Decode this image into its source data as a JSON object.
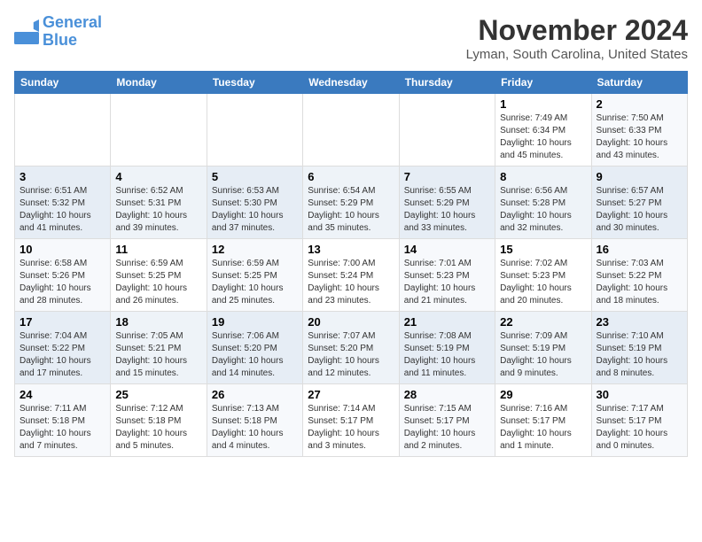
{
  "header": {
    "logo_line1": "General",
    "logo_line2": "Blue",
    "month": "November 2024",
    "location": "Lyman, South Carolina, United States"
  },
  "weekdays": [
    "Sunday",
    "Monday",
    "Tuesday",
    "Wednesday",
    "Thursday",
    "Friday",
    "Saturday"
  ],
  "weeks": [
    [
      {
        "day": "",
        "info": ""
      },
      {
        "day": "",
        "info": ""
      },
      {
        "day": "",
        "info": ""
      },
      {
        "day": "",
        "info": ""
      },
      {
        "day": "",
        "info": ""
      },
      {
        "day": "1",
        "info": "Sunrise: 7:49 AM\nSunset: 6:34 PM\nDaylight: 10 hours\nand 45 minutes."
      },
      {
        "day": "2",
        "info": "Sunrise: 7:50 AM\nSunset: 6:33 PM\nDaylight: 10 hours\nand 43 minutes."
      }
    ],
    [
      {
        "day": "3",
        "info": "Sunrise: 6:51 AM\nSunset: 5:32 PM\nDaylight: 10 hours\nand 41 minutes."
      },
      {
        "day": "4",
        "info": "Sunrise: 6:52 AM\nSunset: 5:31 PM\nDaylight: 10 hours\nand 39 minutes."
      },
      {
        "day": "5",
        "info": "Sunrise: 6:53 AM\nSunset: 5:30 PM\nDaylight: 10 hours\nand 37 minutes."
      },
      {
        "day": "6",
        "info": "Sunrise: 6:54 AM\nSunset: 5:29 PM\nDaylight: 10 hours\nand 35 minutes."
      },
      {
        "day": "7",
        "info": "Sunrise: 6:55 AM\nSunset: 5:29 PM\nDaylight: 10 hours\nand 33 minutes."
      },
      {
        "day": "8",
        "info": "Sunrise: 6:56 AM\nSunset: 5:28 PM\nDaylight: 10 hours\nand 32 minutes."
      },
      {
        "day": "9",
        "info": "Sunrise: 6:57 AM\nSunset: 5:27 PM\nDaylight: 10 hours\nand 30 minutes."
      }
    ],
    [
      {
        "day": "10",
        "info": "Sunrise: 6:58 AM\nSunset: 5:26 PM\nDaylight: 10 hours\nand 28 minutes."
      },
      {
        "day": "11",
        "info": "Sunrise: 6:59 AM\nSunset: 5:25 PM\nDaylight: 10 hours\nand 26 minutes."
      },
      {
        "day": "12",
        "info": "Sunrise: 6:59 AM\nSunset: 5:25 PM\nDaylight: 10 hours\nand 25 minutes."
      },
      {
        "day": "13",
        "info": "Sunrise: 7:00 AM\nSunset: 5:24 PM\nDaylight: 10 hours\nand 23 minutes."
      },
      {
        "day": "14",
        "info": "Sunrise: 7:01 AM\nSunset: 5:23 PM\nDaylight: 10 hours\nand 21 minutes."
      },
      {
        "day": "15",
        "info": "Sunrise: 7:02 AM\nSunset: 5:23 PM\nDaylight: 10 hours\nand 20 minutes."
      },
      {
        "day": "16",
        "info": "Sunrise: 7:03 AM\nSunset: 5:22 PM\nDaylight: 10 hours\nand 18 minutes."
      }
    ],
    [
      {
        "day": "17",
        "info": "Sunrise: 7:04 AM\nSunset: 5:22 PM\nDaylight: 10 hours\nand 17 minutes."
      },
      {
        "day": "18",
        "info": "Sunrise: 7:05 AM\nSunset: 5:21 PM\nDaylight: 10 hours\nand 15 minutes."
      },
      {
        "day": "19",
        "info": "Sunrise: 7:06 AM\nSunset: 5:20 PM\nDaylight: 10 hours\nand 14 minutes."
      },
      {
        "day": "20",
        "info": "Sunrise: 7:07 AM\nSunset: 5:20 PM\nDaylight: 10 hours\nand 12 minutes."
      },
      {
        "day": "21",
        "info": "Sunrise: 7:08 AM\nSunset: 5:19 PM\nDaylight: 10 hours\nand 11 minutes."
      },
      {
        "day": "22",
        "info": "Sunrise: 7:09 AM\nSunset: 5:19 PM\nDaylight: 10 hours\nand 9 minutes."
      },
      {
        "day": "23",
        "info": "Sunrise: 7:10 AM\nSunset: 5:19 PM\nDaylight: 10 hours\nand 8 minutes."
      }
    ],
    [
      {
        "day": "24",
        "info": "Sunrise: 7:11 AM\nSunset: 5:18 PM\nDaylight: 10 hours\nand 7 minutes."
      },
      {
        "day": "25",
        "info": "Sunrise: 7:12 AM\nSunset: 5:18 PM\nDaylight: 10 hours\nand 5 minutes."
      },
      {
        "day": "26",
        "info": "Sunrise: 7:13 AM\nSunset: 5:18 PM\nDaylight: 10 hours\nand 4 minutes."
      },
      {
        "day": "27",
        "info": "Sunrise: 7:14 AM\nSunset: 5:17 PM\nDaylight: 10 hours\nand 3 minutes."
      },
      {
        "day": "28",
        "info": "Sunrise: 7:15 AM\nSunset: 5:17 PM\nDaylight: 10 hours\nand 2 minutes."
      },
      {
        "day": "29",
        "info": "Sunrise: 7:16 AM\nSunset: 5:17 PM\nDaylight: 10 hours\nand 1 minute."
      },
      {
        "day": "30",
        "info": "Sunrise: 7:17 AM\nSunset: 5:17 PM\nDaylight: 10 hours\nand 0 minutes."
      }
    ]
  ]
}
